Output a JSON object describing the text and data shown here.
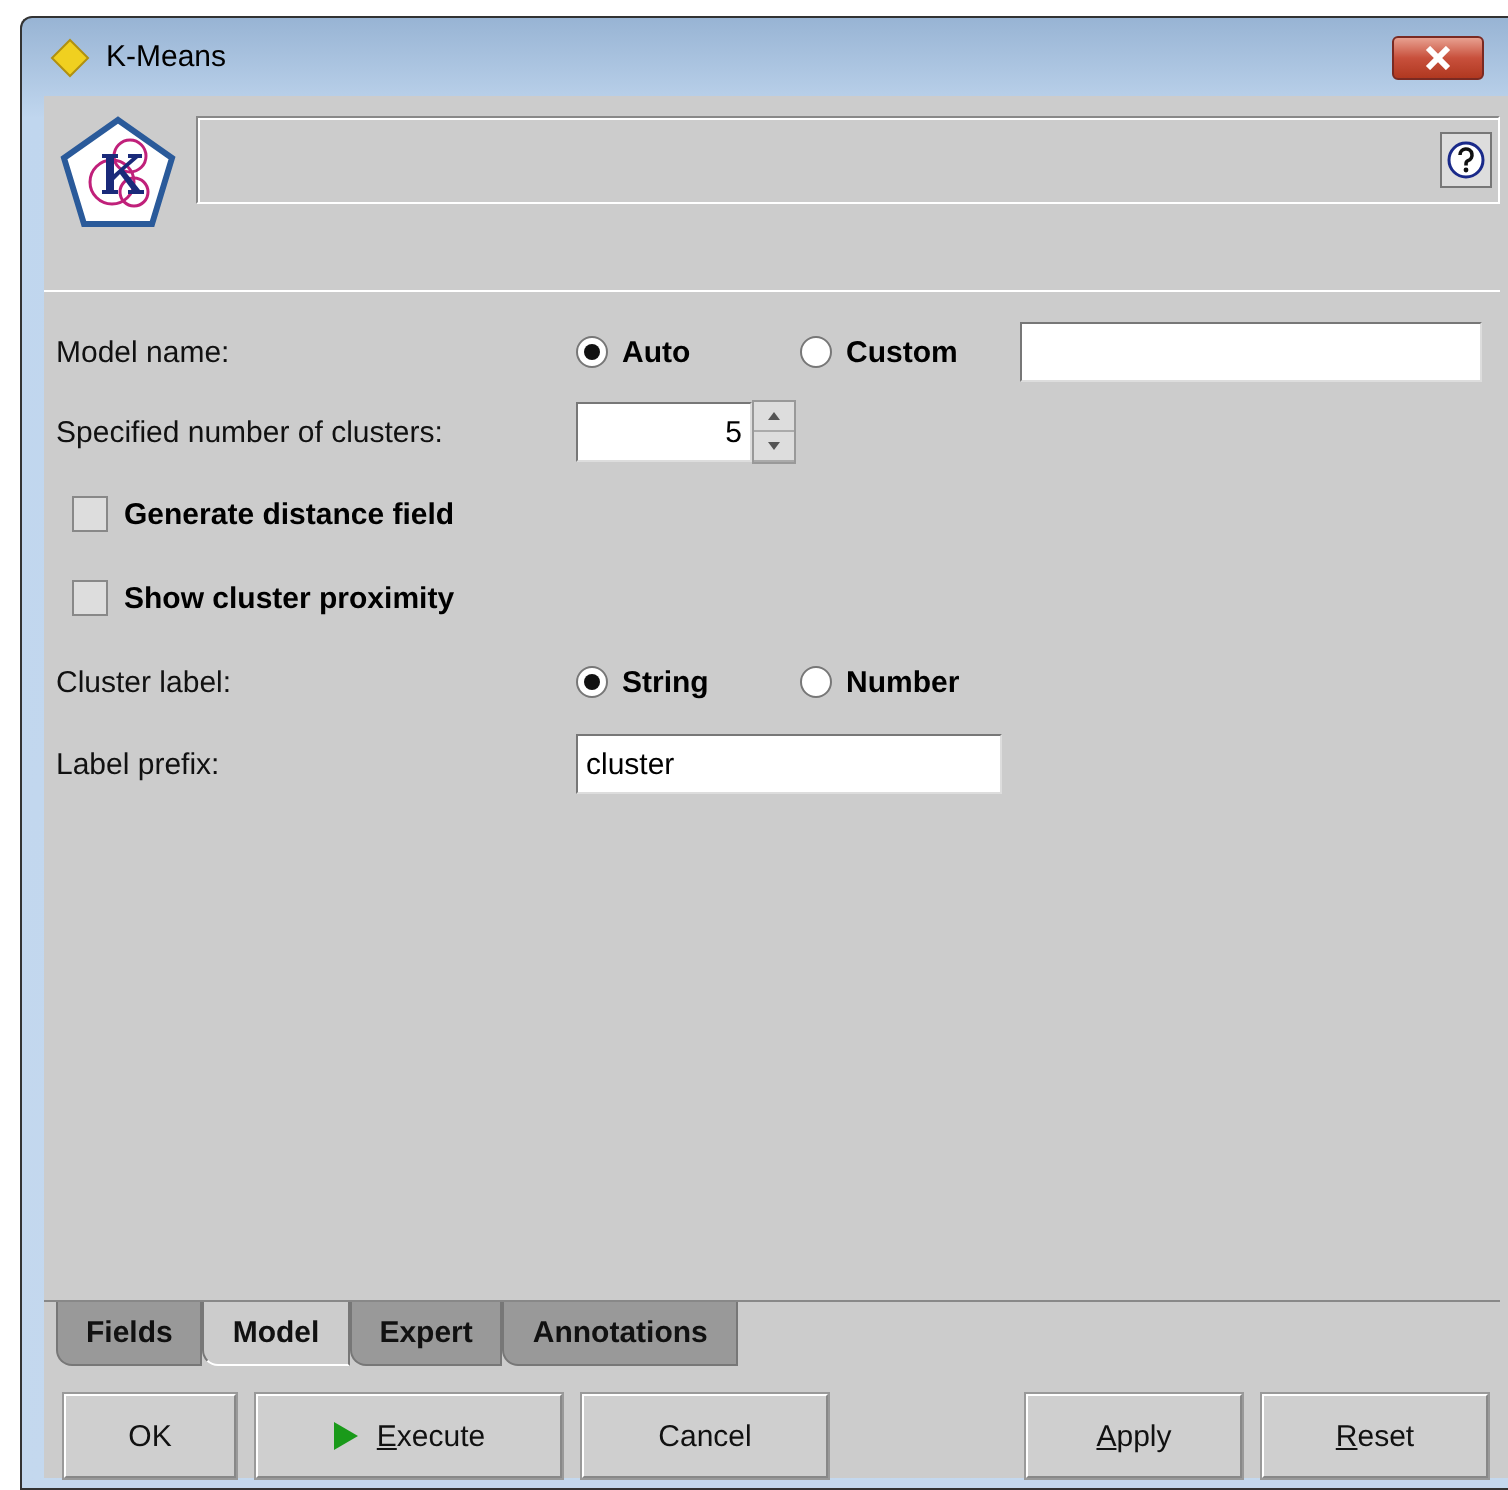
{
  "window": {
    "title": "K-Means"
  },
  "form": {
    "model_name": {
      "label": "Model name:",
      "options": [
        {
          "label": "Auto",
          "selected": true
        },
        {
          "label": "Custom",
          "selected": false
        }
      ]
    },
    "clusters": {
      "label": "Specified number of clusters:",
      "value": "5"
    },
    "checkboxes": [
      {
        "label": "Generate distance field",
        "checked": false
      },
      {
        "label": "Show cluster proximity",
        "checked": false
      }
    ],
    "cluster_label": {
      "label": "Cluster label:",
      "options": [
        {
          "label": "String",
          "selected": true
        },
        {
          "label": "Number",
          "selected": false
        }
      ]
    },
    "label_prefix": {
      "label": "Label prefix:",
      "value": "cluster"
    }
  },
  "tabs": [
    {
      "label": "Fields",
      "selected": false
    },
    {
      "label": "Model",
      "selected": true
    },
    {
      "label": "Expert",
      "selected": false
    },
    {
      "label": "Annotations",
      "selected": false
    }
  ],
  "buttons": [
    {
      "label": "OK",
      "kind": "plain",
      "mnemonic": false
    },
    {
      "label": "Execute",
      "kind": "run",
      "mnemonic": true
    },
    {
      "label": "Cancel",
      "kind": "plain",
      "mnemonic": false
    },
    {
      "label": "Apply",
      "kind": "spacer",
      "mnemonic": true
    },
    {
      "label": "Reset",
      "kind": "plain",
      "mnemonic": true
    }
  ]
}
